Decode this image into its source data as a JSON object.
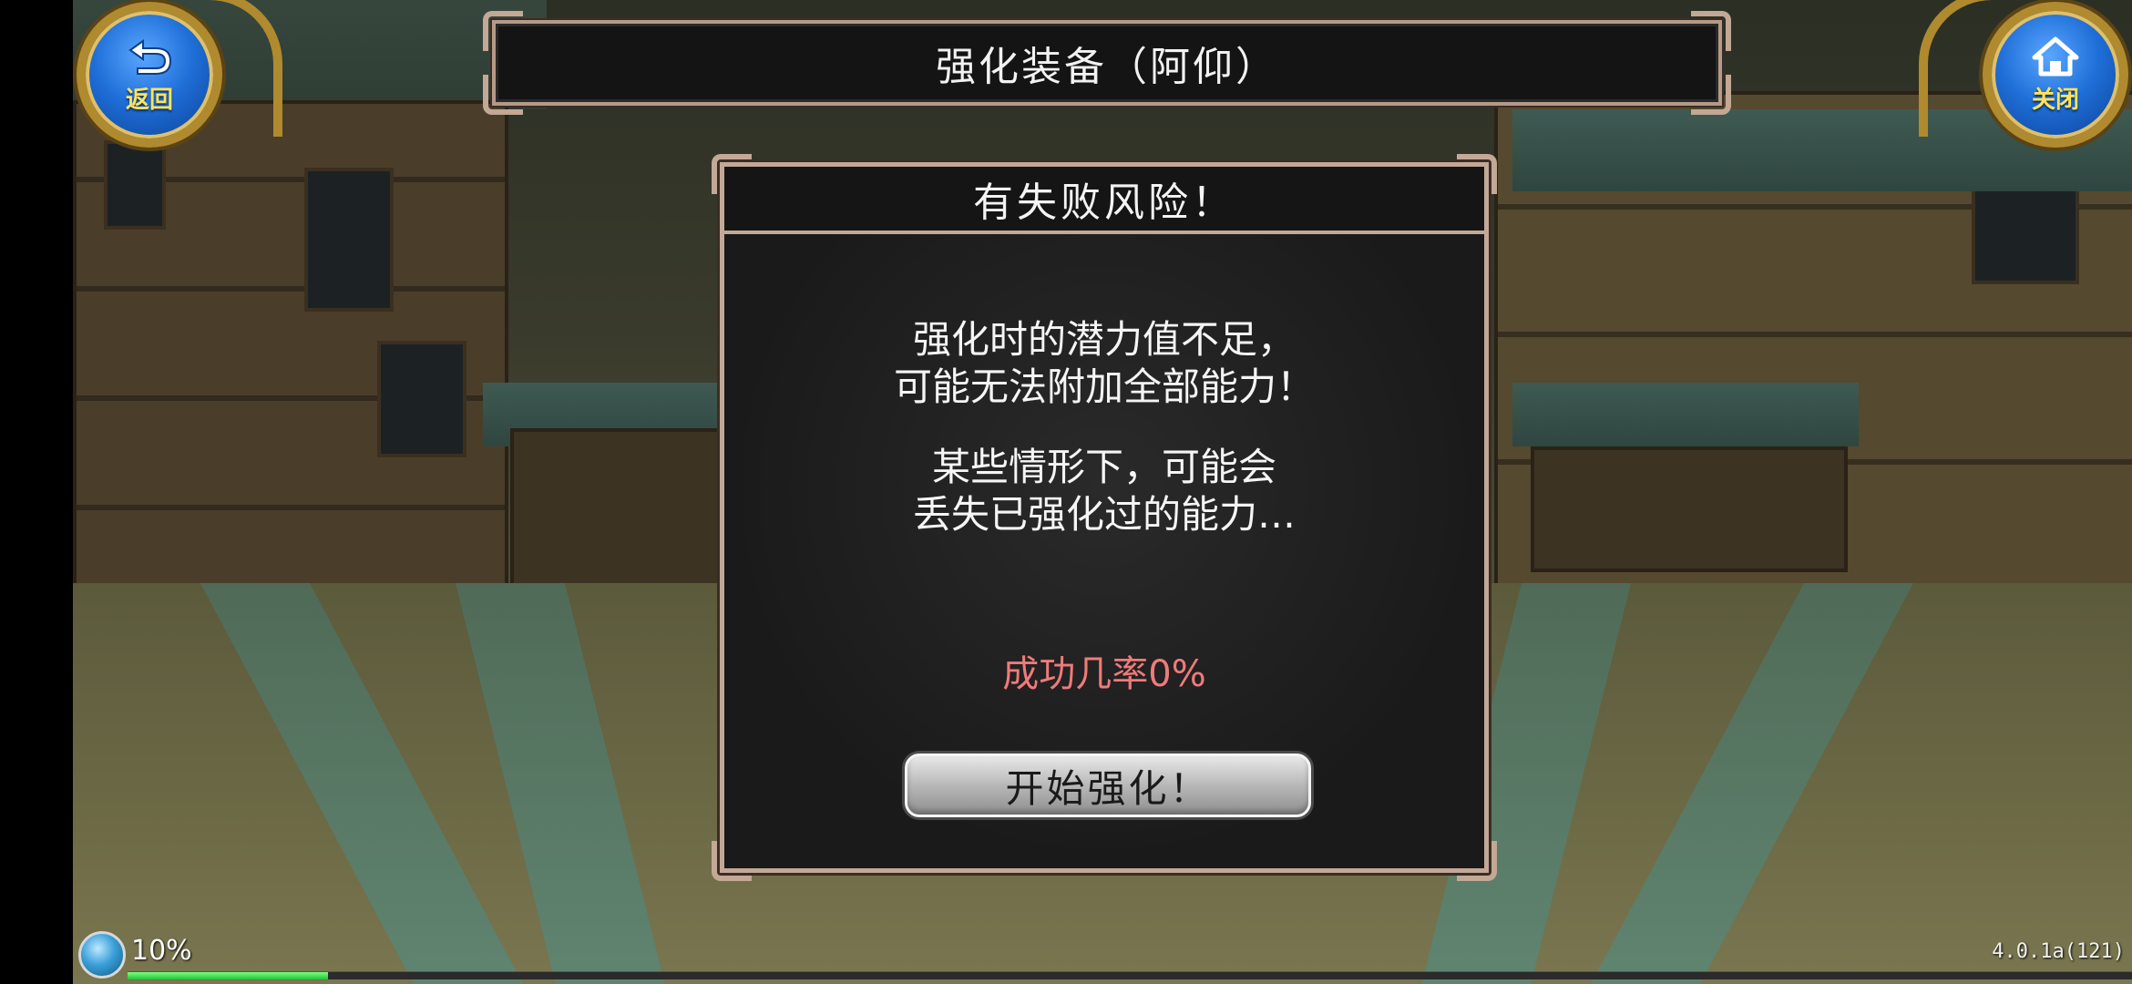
{
  "header": {
    "title": "强化装备（阿仰）",
    "back_label": "返回",
    "close_label": "关闭"
  },
  "dialog": {
    "title": "有失败风险！",
    "message1_line1": "强化时的潜力值不足，",
    "message1_line2": "可能无法附加全部能力！",
    "message2_line1": "某些情形下，可能会",
    "message2_line2": "丢失已强化过的能力…",
    "success_rate": "成功几率0%",
    "start_button": "开始强化！"
  },
  "hud": {
    "progress_text": "10%",
    "progress_value": 0.1,
    "version": "4.0.1a(121)"
  },
  "colors": {
    "accent_red": "#f07a7a",
    "button_blue": "#1f6fd8",
    "label_yellow": "#ffe45a",
    "progress_green": "#1fc43a"
  },
  "icons": {
    "back": "back-arrow-icon",
    "close": "home-icon",
    "orb": "orb-icon"
  }
}
